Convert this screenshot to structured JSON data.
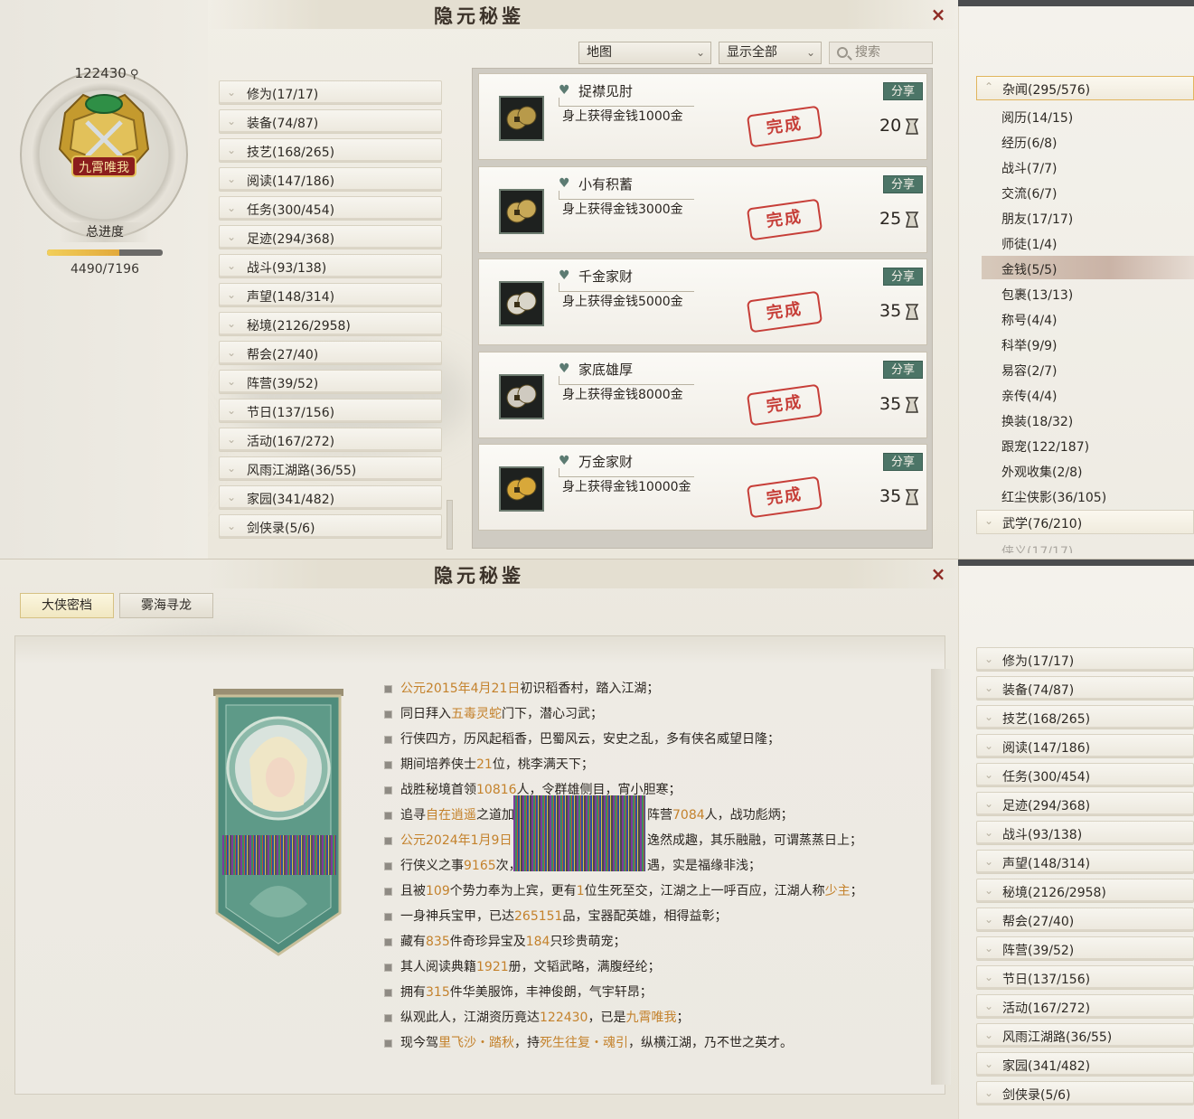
{
  "window": {
    "title": "隐元秘鉴",
    "close": "×"
  },
  "profile": {
    "score": "122430",
    "medal_text": "九霄唯我",
    "progress_label": "总进度",
    "progress_text": "4490/7196",
    "progress_fraction": 0.6234
  },
  "categories": [
    "修为(17/17)",
    "装备(74/87)",
    "技艺(168/265)",
    "阅读(147/186)",
    "任务(300/454)",
    "足迹(294/368)",
    "战斗(93/138)",
    "声望(148/314)",
    "秘境(2126/2958)",
    "帮会(27/40)",
    "阵营(39/52)",
    "节日(137/156)",
    "活动(167/272)",
    "风雨江湖路(36/55)",
    "家园(341/482)",
    "剑侠录(5/6)"
  ],
  "toolbar": {
    "map_select": "地图",
    "filter_select": "显示全部",
    "search_placeholder": "搜索"
  },
  "achievements": [
    {
      "name": "捉襟见肘",
      "desc": "身上获得金钱1000金",
      "points": "20",
      "share": "分享",
      "stamp": "完成",
      "icon": "coins-icon"
    },
    {
      "name": "小有积蓄",
      "desc": "身上获得金钱3000金",
      "points": "25",
      "share": "分享",
      "stamp": "完成",
      "icon": "coin-pile-icon"
    },
    {
      "name": "千金家财",
      "desc": "身上获得金钱5000金",
      "points": "35",
      "share": "分享",
      "stamp": "完成",
      "icon": "silver-icon"
    },
    {
      "name": "家底雄厚",
      "desc": "身上获得金钱8000金",
      "points": "35",
      "share": "分享",
      "stamp": "完成",
      "icon": "silver-pile-icon"
    },
    {
      "name": "万金家财",
      "desc": "身上获得金钱10000金",
      "points": "35",
      "share": "分享",
      "stamp": "完成",
      "icon": "gold-ingot-icon"
    }
  ],
  "subcategories": {
    "header": "杂闻(295/576)",
    "items": [
      "阅历(14/15)",
      "经历(6/8)",
      "战斗(7/7)",
      "交流(6/7)",
      "朋友(17/17)",
      "师徒(1/4)",
      "金钱(5/5)",
      "包裹(13/13)",
      "称号(4/4)",
      "科举(9/9)",
      "易容(2/7)",
      "亲传(4/4)",
      "换装(18/32)",
      "跟宠(122/187)",
      "外观收集(2/8)",
      "红尘侠影(36/105)"
    ],
    "selected": "金钱(5/5)",
    "next_header": "武学(76/210)",
    "partial": "侠义(17/17)"
  },
  "bottom": {
    "tabs": [
      "大侠密档",
      "雾海寻龙"
    ],
    "bio": [
      [
        {
          "t": "公元2015年4月21日",
          "h": true
        },
        {
          "t": "初识稻香村，踏入江湖；"
        }
      ],
      [
        {
          "t": "同日拜入"
        },
        {
          "t": "五毒灵蛇",
          "h": true
        },
        {
          "t": "门下，潜心习武；"
        }
      ],
      [
        {
          "t": "行侠四方，历风起稻香，巴蜀风云，安史之乱，多有侠名威望日隆；"
        }
      ],
      [
        {
          "t": "期间培养侠士"
        },
        {
          "t": "21",
          "h": true
        },
        {
          "t": "位，桃李满天下；"
        }
      ],
      [
        {
          "t": "战胜秘境首领"
        },
        {
          "t": "10816",
          "h": true
        },
        {
          "t": "人，令群雄侧目，宵小胆寒；"
        }
      ],
      [
        {
          "t": "追寻"
        },
        {
          "t": "自在逍遥",
          "h": true
        },
        {
          "t": "之道加"
        },
        {
          "t": "GAP"
        },
        {
          "t": "阵营"
        },
        {
          "t": "7084",
          "h": true
        },
        {
          "t": "人，战功彪炳；"
        }
      ],
      [
        {
          "t": "公元2024年1月9日",
          "h": true
        },
        {
          "t": "GAP"
        },
        {
          "t": "逸然成趣，其乐融融，可谓蒸蒸日上；"
        }
      ],
      [
        {
          "t": "行侠义之事"
        },
        {
          "t": "9165",
          "h": true
        },
        {
          "t": "次，"
        },
        {
          "t": "GAP"
        },
        {
          "t": "遇，实是福缘非浅；"
        }
      ],
      [
        {
          "t": "且被"
        },
        {
          "t": "109",
          "h": true
        },
        {
          "t": "个势力奉为上宾，更有"
        },
        {
          "t": "1",
          "h": true
        },
        {
          "t": "位生死至交，江湖之上一呼百应，江湖人称"
        },
        {
          "t": "少主",
          "h": true
        },
        {
          "t": "；"
        }
      ],
      [
        {
          "t": "一身神兵宝甲，已达"
        },
        {
          "t": "265151",
          "h": true
        },
        {
          "t": "品，宝器配英雄，相得益彰；"
        }
      ],
      [
        {
          "t": "藏有"
        },
        {
          "t": "835",
          "h": true
        },
        {
          "t": "件奇珍异宝及"
        },
        {
          "t": "184",
          "h": true
        },
        {
          "t": "只珍贵萌宠；"
        }
      ],
      [
        {
          "t": "其人阅读典籍"
        },
        {
          "t": "1921",
          "h": true
        },
        {
          "t": "册，文韬武略，满腹经纶；"
        }
      ],
      [
        {
          "t": "拥有"
        },
        {
          "t": "315",
          "h": true
        },
        {
          "t": "件华美服饰，丰神俊朗，气宇轩昂；"
        }
      ],
      [
        {
          "t": "纵观此人，江湖资历竟达"
        },
        {
          "t": "122430",
          "h": true
        },
        {
          "t": "，已是"
        },
        {
          "t": "九霄唯我",
          "h": true
        },
        {
          "t": "；"
        }
      ],
      [
        {
          "t": "现今驾"
        },
        {
          "t": "里飞沙・踏秋",
          "h": true
        },
        {
          "t": "，持"
        },
        {
          "t": "死生往复・魂引",
          "h": true
        },
        {
          "t": "，纵横江湖，乃不世之英才。"
        }
      ]
    ]
  },
  "colors": {
    "highlight": "#c4822c",
    "share_bg": "#4c7567",
    "stamp": "#c22b25",
    "close": "#8e2a24"
  }
}
